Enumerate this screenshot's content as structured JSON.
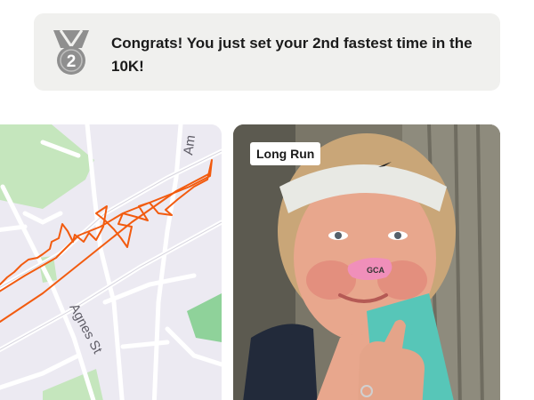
{
  "achievement": {
    "message": "Congrats! You just set your 2nd fastest time in the 10K!",
    "rank_badge": "2",
    "icon": "medal-icon"
  },
  "map": {
    "street_labels": [
      "Agnes St",
      "Am"
    ],
    "route_color": "#f25b0f",
    "park_color": "#bfe3b8"
  },
  "photo": {
    "tag": "Long Run",
    "nose_strip_text": "GCA"
  }
}
